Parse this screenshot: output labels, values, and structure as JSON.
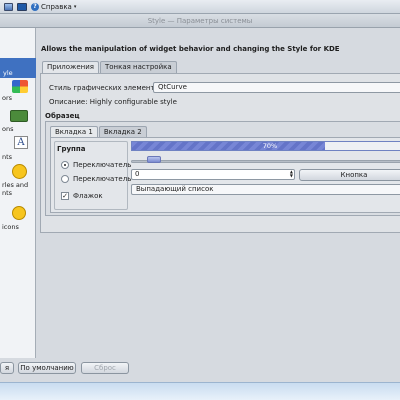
{
  "menubar": {
    "items": [
      {
        "label": "",
        "icon": "app-icon"
      },
      {
        "label": "",
        "icon": "monitor-icon"
      },
      {
        "label": "Справка",
        "icon": "help-icon"
      }
    ]
  },
  "window": {
    "title": "Style — Параметры системы"
  },
  "sidebar": {
    "items": [
      {
        "label": "yle",
        "icon": "style-icon",
        "selected": true
      },
      {
        "label": "ors",
        "icon": "colors-icon",
        "selected": false
      },
      {
        "label": "ons",
        "icon": "icons-icon",
        "selected": false
      },
      {
        "label": "nts",
        "icon": "fonts-icon",
        "selected": false
      },
      {
        "label": "rles and",
        "label2": "nts",
        "icon": "emoticon-icon",
        "selected": false
      },
      {
        "label": "icons",
        "icon": "emoticons-icon",
        "selected": false
      }
    ]
  },
  "main": {
    "description": "Allows the manipulation of widget behavior and changing the Style for KDE",
    "tabs": [
      "Приложения",
      "Тонкая настройка"
    ],
    "style_label": "Стиль графических элементов:",
    "style_value": "QtCurve",
    "style_description": "Описание: Highly configurable style",
    "sample_title": "Образец",
    "sample_tabs": [
      "Вкладка 1",
      "Вкладка 2"
    ],
    "group_title": "Группа",
    "radio1": "Переключатель",
    "radio2": "Переключатель",
    "checkbox": "Флажок",
    "progress_text": "70%",
    "progress_value": 0.7,
    "spin_value": "0",
    "button_label": "Кнопка",
    "dropdown_label": "Выпадающий список"
  },
  "footer": {
    "apply": "я",
    "defaults": "По умолчанию",
    "reset": "Сброс"
  },
  "colors": {
    "selected": "#3f71c1",
    "progress": "#7786d6"
  }
}
